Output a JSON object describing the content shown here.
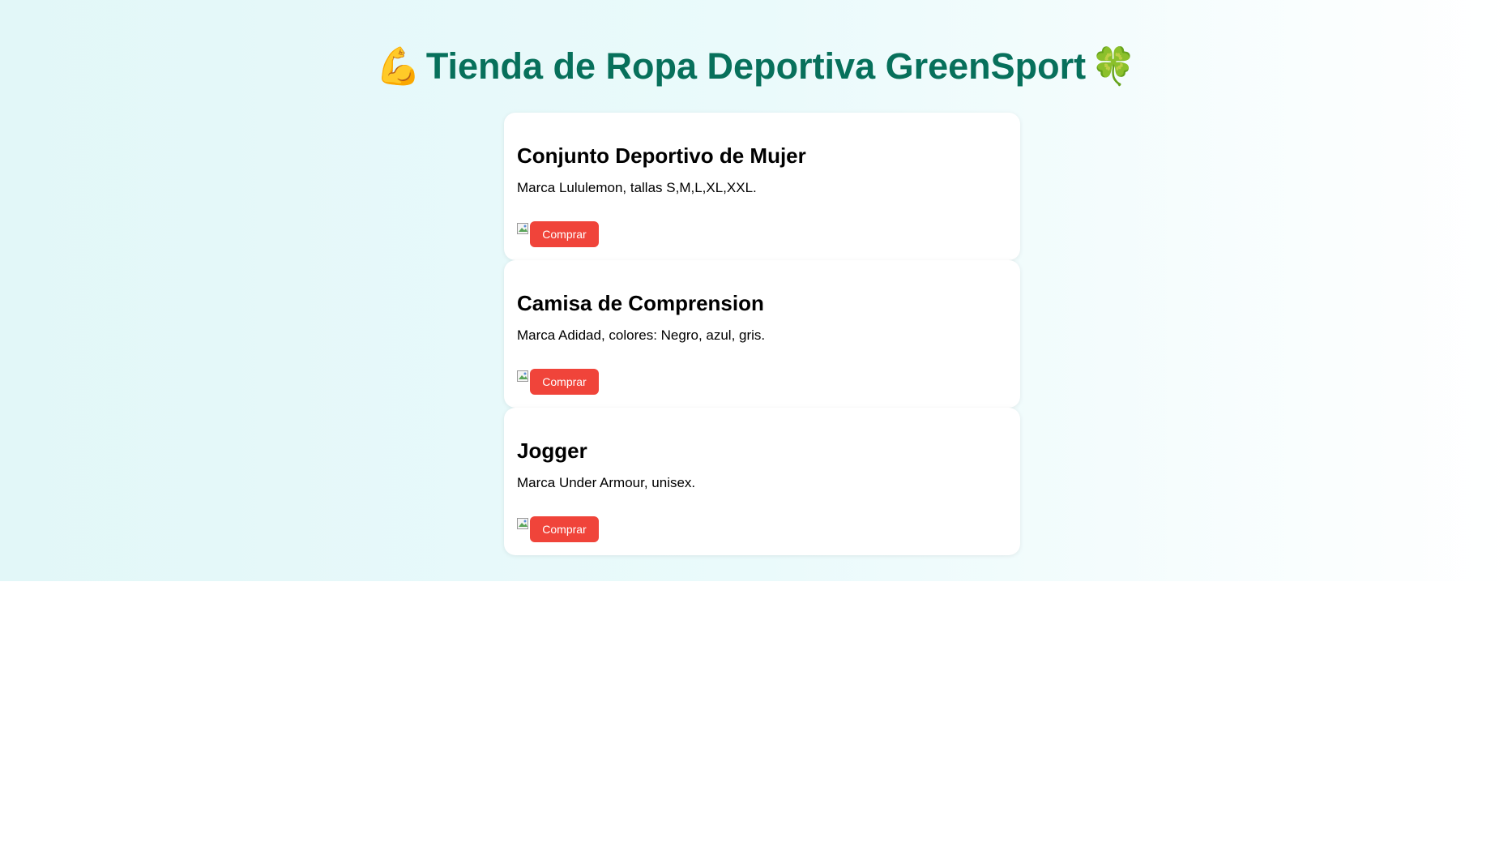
{
  "header": {
    "title": "Tienda de Ropa Deportiva GreenSport",
    "left_emoji": "💪",
    "right_emoji": "🍀"
  },
  "products": [
    {
      "name": "Conjunto Deportivo de Mujer",
      "description": "Marca Lululemon, tallas S,M,L,XL,XXL.",
      "button_label": "Comprar"
    },
    {
      "name": "Camisa de Comprension",
      "description": "Marca Adidad, colores: Negro, azul, gris.",
      "button_label": "Comprar"
    },
    {
      "name": "Jogger",
      "description": "Marca Under Armour, unisex.",
      "button_label": "Comprar"
    }
  ],
  "icons": {
    "product_image": "broken-image-icon"
  },
  "colors": {
    "title": "#07705b",
    "button": "#f0443a",
    "background_gradient_start": "#e2f7f8",
    "background_gradient_end": "#ffffff"
  }
}
